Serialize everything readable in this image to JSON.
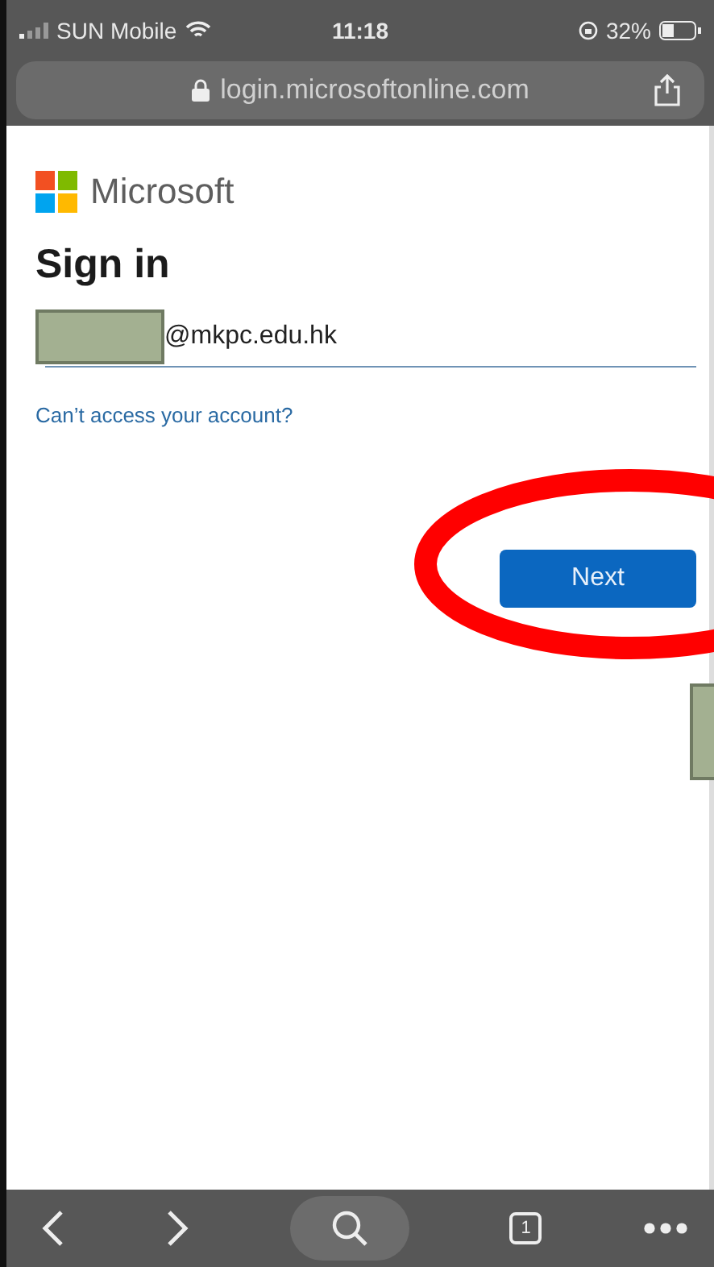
{
  "status_bar": {
    "carrier": "SUN Mobile",
    "time": "11:18",
    "battery": "32%"
  },
  "address_bar": {
    "url": "login.microsoftonline.com"
  },
  "page": {
    "brand": "Microsoft",
    "title": "Sign in",
    "email": "@mkpc.edu.hk",
    "link": "Can’t access your account?",
    "button": "Next"
  },
  "toolbar": {
    "tab_count": "1"
  }
}
